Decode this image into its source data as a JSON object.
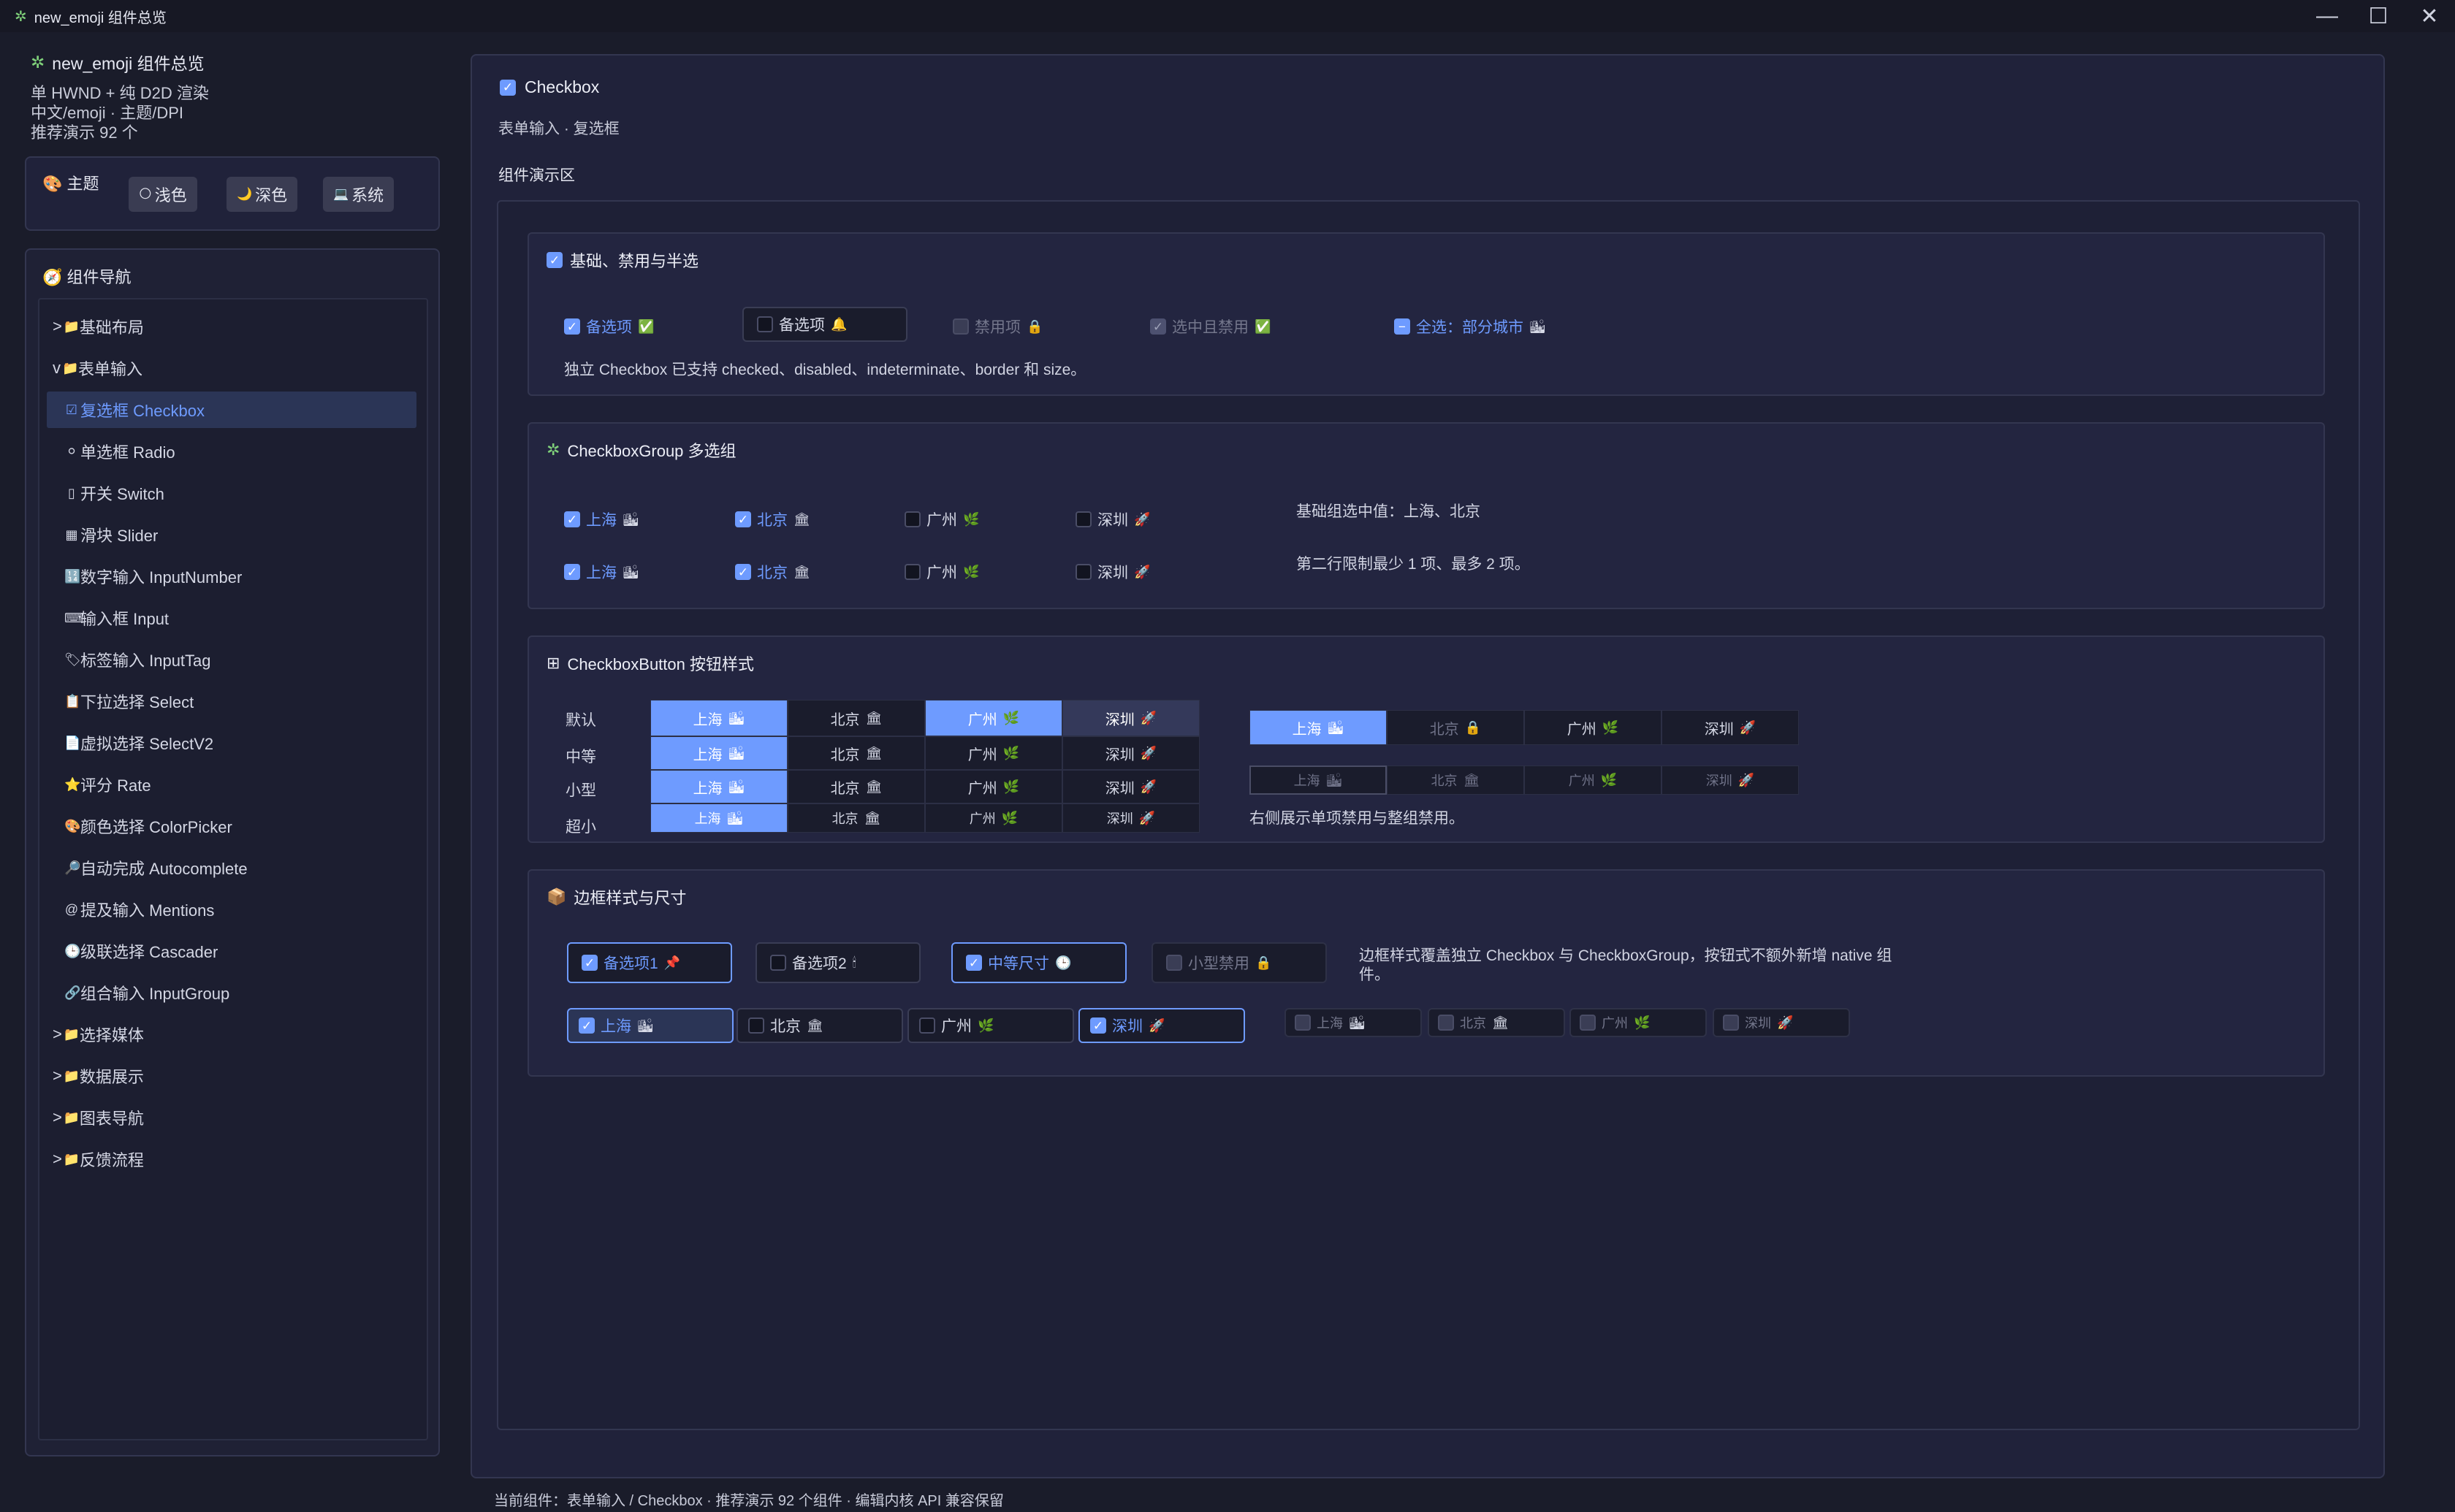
{
  "window": {
    "title": "new_emoji 组件总览",
    "icon": "puzzle-icon"
  },
  "window_buttons": {
    "minimize": "—",
    "maximize": "☐",
    "close": "✕"
  },
  "sidebar": {
    "title": "new_emoji 组件总览",
    "sub1": "单 HWND + 纯 D2D 渲染",
    "sub2": "中文/emoji · 主题/DPI",
    "sub3": "推荐演示 92 个",
    "theme": {
      "label": "主题",
      "buttons": [
        {
          "icon": "🌕",
          "label": "浅色"
        },
        {
          "icon": "🌙",
          "label": "深色"
        },
        {
          "icon": "💻",
          "label": "系统"
        }
      ]
    },
    "nav_title": "组件导航",
    "nav": [
      {
        "prefix": ">",
        "icon": "📁",
        "label": "基础布局"
      },
      {
        "prefix": "v",
        "icon": "📁",
        "label": "表单输入"
      },
      {
        "prefix": "",
        "icon": "☑",
        "label": "复选框 Checkbox",
        "active": true
      },
      {
        "prefix": "",
        "icon": "⚪",
        "label": "单选框 Radio"
      },
      {
        "prefix": "",
        "icon": "▯",
        "label": "开关 Switch"
      },
      {
        "prefix": "",
        "icon": "▦",
        "label": "滑块 Slider"
      },
      {
        "prefix": "",
        "icon": "🔢",
        "label": "数字输入 InputNumber"
      },
      {
        "prefix": "",
        "icon": "⌨",
        "label": "输入框 Input"
      },
      {
        "prefix": "",
        "icon": "🏷",
        "label": "标签输入 InputTag"
      },
      {
        "prefix": "",
        "icon": "📋",
        "label": "下拉选择 Select"
      },
      {
        "prefix": "",
        "icon": "📄",
        "label": "虚拟选择 SelectV2"
      },
      {
        "prefix": "",
        "icon": "⭐",
        "label": "评分 Rate"
      },
      {
        "prefix": "",
        "icon": "🎨",
        "label": "颜色选择 ColorPicker"
      },
      {
        "prefix": "",
        "icon": "🔎",
        "label": "自动完成 Autocomplete"
      },
      {
        "prefix": "",
        "icon": "@",
        "label": "提及输入 Mentions"
      },
      {
        "prefix": "",
        "icon": "🕒",
        "label": "级联选择 Cascader"
      },
      {
        "prefix": "",
        "icon": "🔗",
        "label": "组合输入 InputGroup"
      },
      {
        "prefix": ">",
        "icon": "📁",
        "label": "选择媒体"
      },
      {
        "prefix": ">",
        "icon": "📁",
        "label": "数据展示"
      },
      {
        "prefix": ">",
        "icon": "📁",
        "label": "图表导航"
      },
      {
        "prefix": ">",
        "icon": "📁",
        "label": "反馈流程"
      }
    ]
  },
  "main": {
    "title": "Checkbox",
    "subtitle": "表单输入 · 复选框",
    "demo_label": "组件演示区",
    "basic": {
      "title": "基础、禁用与半选",
      "items": [
        {
          "label": "备选项",
          "emoji": "✅",
          "state": "on"
        },
        {
          "label": "备选项",
          "emoji": "🔔",
          "state": "off"
        },
        {
          "label": "禁用项",
          "emoji": "🔒",
          "state": "dis"
        },
        {
          "label": "选中且禁用",
          "emoji": "✅",
          "state": "dison"
        },
        {
          "label": "全选：部分城市",
          "emoji": "🏙",
          "state": "ind"
        }
      ],
      "note": "独立 Checkbox 已支持 checked、disabled、indeterminate、border 和 size。"
    },
    "group": {
      "title": "CheckboxGroup 多选组",
      "row1": [
        {
          "label": "上海",
          "emoji": "🏙",
          "state": "on"
        },
        {
          "label": "北京",
          "emoji": "🏛",
          "state": "on"
        },
        {
          "label": "广州",
          "emoji": "🌿",
          "state": "off"
        },
        {
          "label": "深圳",
          "emoji": "🚀",
          "state": "off"
        }
      ],
      "row2": [
        {
          "label": "上海",
          "emoji": "🏙",
          "state": "on"
        },
        {
          "label": "北京",
          "emoji": "🏛",
          "state": "on"
        },
        {
          "label": "广州",
          "emoji": "🌿",
          "state": "off"
        },
        {
          "label": "深圳",
          "emoji": "🚀",
          "state": "off"
        }
      ],
      "note1": "基础组选中值：上海、北京",
      "note2": "第二行限制最少 1 项、最多 2 项。"
    },
    "buttons": {
      "title": "CheckboxButton 按钮样式",
      "row_labels": [
        "默认",
        "中等",
        "小型",
        "超小"
      ],
      "cities": [
        {
          "label": "上海",
          "emoji": "🏙"
        },
        {
          "label": "北京",
          "emoji": "🏛"
        },
        {
          "label": "广州",
          "emoji": "🌿"
        },
        {
          "label": "深圳",
          "emoji": "🚀"
        }
      ],
      "right_row1": [
        {
          "label": "上海",
          "emoji": "🏙"
        },
        {
          "label": "北京",
          "emoji": "🔒"
        },
        {
          "label": "广州",
          "emoji": "🌿"
        },
        {
          "label": "深圳",
          "emoji": "🚀"
        }
      ],
      "right_row2": [
        {
          "label": "上海",
          "emoji": "🏙"
        },
        {
          "label": "北京",
          "emoji": "🏛"
        },
        {
          "label": "广州",
          "emoji": "🌿"
        },
        {
          "label": "深圳",
          "emoji": "🚀"
        }
      ],
      "note": "右侧展示单项禁用与整组禁用。"
    },
    "border": {
      "title": "边框样式与尺寸",
      "row1": [
        {
          "label": "备选项1",
          "emoji": "📌",
          "state": "on"
        },
        {
          "label": "备选项2",
          "emoji": "🕯",
          "state": "off"
        },
        {
          "label": "中等尺寸",
          "emoji": "🕒",
          "state": "on"
        },
        {
          "label": "小型禁用",
          "emoji": "🔒",
          "state": "dis"
        }
      ],
      "row2": [
        {
          "label": "上海",
          "emoji": "🏙",
          "state": "on"
        },
        {
          "label": "北京",
          "emoji": "🏛",
          "state": "off"
        },
        {
          "label": "广州",
          "emoji": "🌿",
          "state": "off"
        },
        {
          "label": "深圳",
          "emoji": "🚀",
          "state": "on"
        }
      ],
      "row2_disabled": [
        {
          "label": "上海",
          "emoji": "🏙"
        },
        {
          "label": "北京",
          "emoji": "🏛"
        },
        {
          "label": "广州",
          "emoji": "🌿"
        },
        {
          "label": "深圳",
          "emoji": "🚀"
        }
      ],
      "note_line1": "边框样式覆盖独立 Checkbox 与 CheckboxGroup，按钮式不额外新增 native 组",
      "note_line2": "件。"
    }
  },
  "status": "当前组件：表单输入 / Checkbox · 推荐演示 92 个组件 · 编辑内核 API 兼容保留",
  "colors": {
    "accent": "#6e9bff",
    "background": "#1a1c2a",
    "panel": "#20223a"
  }
}
